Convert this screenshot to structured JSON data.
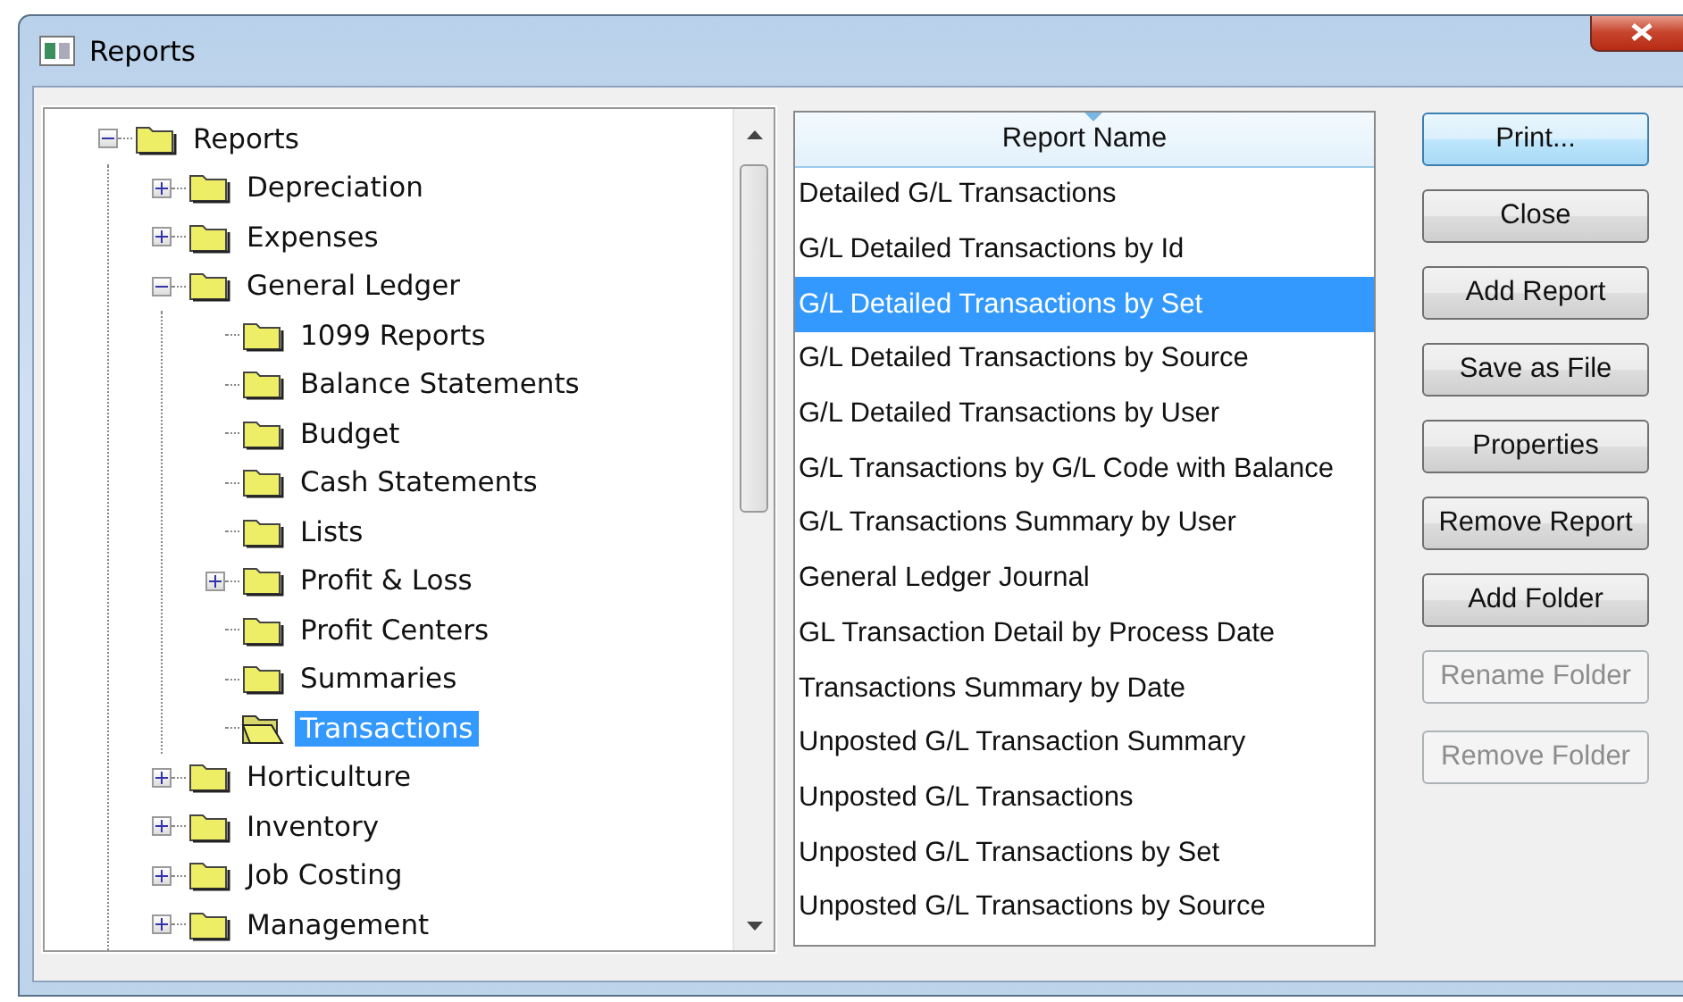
{
  "window": {
    "title": "Reports"
  },
  "tree": [
    {
      "label": "Reports",
      "expanded": true,
      "selected": false,
      "children": [
        {
          "label": "Depreciation",
          "expanded": false,
          "selected": false
        },
        {
          "label": "Expenses",
          "expanded": false,
          "selected": false
        },
        {
          "label": "General Ledger",
          "expanded": true,
          "selected": false,
          "children": [
            {
              "label": "1099 Reports",
              "selected": false
            },
            {
              "label": "Balance Statements",
              "selected": false
            },
            {
              "label": "Budget",
              "selected": false
            },
            {
              "label": "Cash Statements",
              "selected": false
            },
            {
              "label": "Lists",
              "selected": false
            },
            {
              "label": "Profit & Loss",
              "expanded": false,
              "selected": false
            },
            {
              "label": "Profit Centers",
              "selected": false
            },
            {
              "label": "Summaries",
              "selected": false
            },
            {
              "label": "Transactions",
              "selected": true
            }
          ]
        },
        {
          "label": "Horticulture",
          "expanded": false,
          "selected": false
        },
        {
          "label": "Inventory",
          "expanded": false,
          "selected": false
        },
        {
          "label": "Job Costing",
          "expanded": false,
          "selected": false
        },
        {
          "label": "Management",
          "expanded": false,
          "selected": false
        }
      ]
    }
  ],
  "report_list": {
    "column": "Report Name",
    "rows": [
      {
        "name": "Detailed G/L Transactions",
        "selected": false
      },
      {
        "name": "G/L Detailed Transactions by Id",
        "selected": false
      },
      {
        "name": "G/L Detailed Transactions by Set",
        "selected": true
      },
      {
        "name": "G/L Detailed Transactions by Source",
        "selected": false
      },
      {
        "name": "G/L Detailed Transactions by User",
        "selected": false
      },
      {
        "name": "G/L Transactions by G/L Code with Balance",
        "selected": false
      },
      {
        "name": "G/L Transactions Summary by User",
        "selected": false
      },
      {
        "name": "General Ledger Journal",
        "selected": false
      },
      {
        "name": "GL Transaction Detail by Process Date",
        "selected": false
      },
      {
        "name": "Transactions Summary by Date",
        "selected": false
      },
      {
        "name": "Unposted G/L Transaction Summary",
        "selected": false
      },
      {
        "name": "Unposted G/L Transactions",
        "selected": false
      },
      {
        "name": "Unposted G/L Transactions by Set",
        "selected": false
      },
      {
        "name": "Unposted G/L Transactions by Source",
        "selected": false
      }
    ]
  },
  "buttons": [
    {
      "label": "Print...",
      "default": true,
      "disabled": false
    },
    {
      "label": "Close",
      "default": false,
      "disabled": false
    },
    {
      "label": "Add Report",
      "default": false,
      "disabled": false
    },
    {
      "label": "Save as File",
      "default": false,
      "disabled": false
    },
    {
      "label": "Properties",
      "default": false,
      "disabled": false
    },
    {
      "label": "Remove Report",
      "default": false,
      "disabled": false
    },
    {
      "label": "Add Folder",
      "default": false,
      "disabled": false
    },
    {
      "label": "Rename Folder",
      "default": false,
      "disabled": true
    },
    {
      "label": "Remove Folder",
      "default": false,
      "disabled": true
    }
  ]
}
